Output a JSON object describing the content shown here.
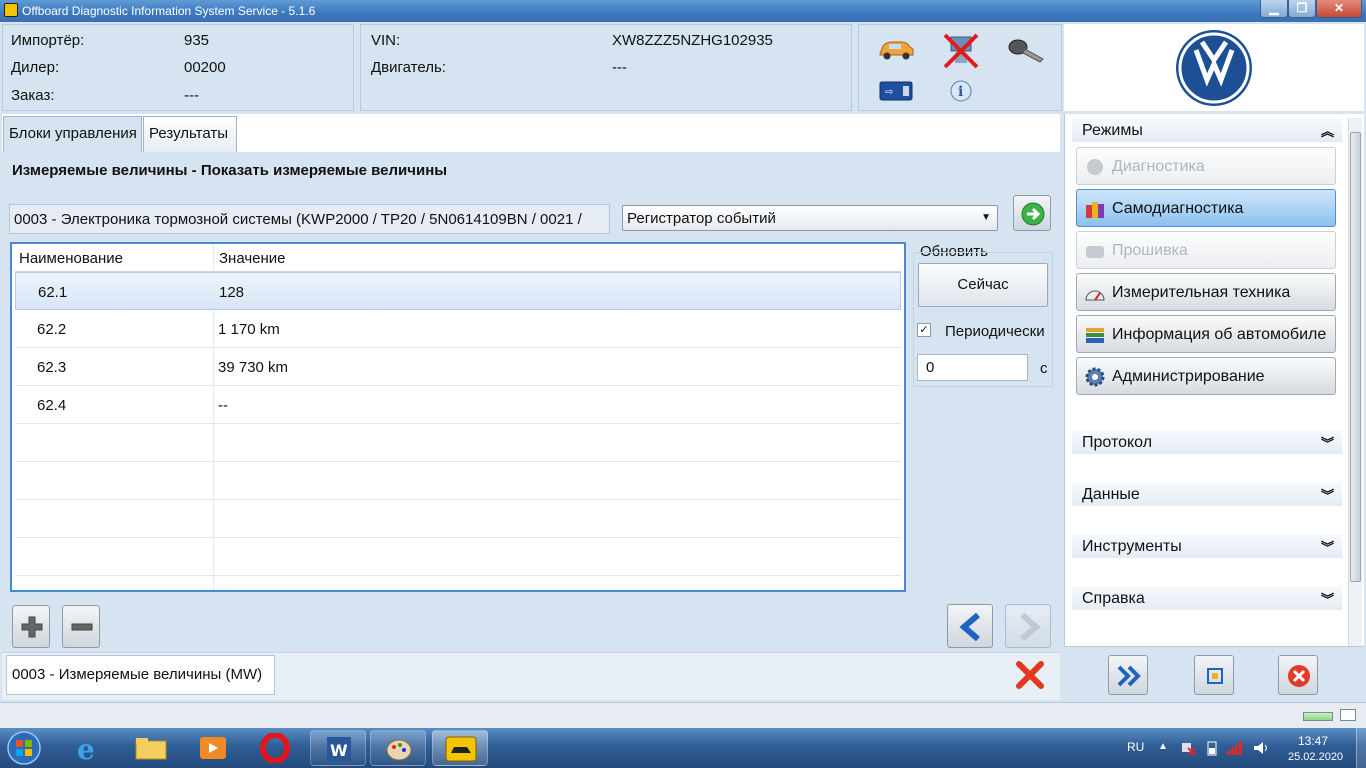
{
  "window": {
    "title": "Offboard Diagnostic Information System Service - 5.1.6"
  },
  "info": {
    "importer_label": "Импортёр:",
    "importer_value": "935",
    "dealer_label": "Дилер:",
    "dealer_value": "00200",
    "order_label": "Заказ:",
    "order_value": "---",
    "vin_label": "VIN:",
    "vin_value": "XW8ZZZ5NZHG102935",
    "engine_label": "Двигатель:",
    "engine_value": "---"
  },
  "tabs": [
    {
      "label": "Блоки управления"
    },
    {
      "label": "Результаты"
    }
  ],
  "main": {
    "heading": "Измеряемые величины - Показать измеряемые величины",
    "ecu_field": "0003 - Электроника тормозной системы  (KWP2000 / TP20 / 5N0614109BN / 0021 /",
    "dropdown_value": "Регистратор событий",
    "table": {
      "columns": [
        "Наименование",
        "Значение"
      ],
      "rows": [
        {
          "name": "62.1",
          "value": "128"
        },
        {
          "name": "62.2",
          "value": "1 170 km"
        },
        {
          "name": "62.3",
          "value": "39 730 km"
        },
        {
          "name": "62.4",
          "value": "--"
        },
        {
          "name": "",
          "value": ""
        },
        {
          "name": "",
          "value": ""
        },
        {
          "name": "",
          "value": ""
        },
        {
          "name": "",
          "value": ""
        }
      ]
    },
    "refresh": {
      "group_label": "Обновить",
      "now_button": "Сейчас",
      "periodic_label": "Периодически",
      "periodic_checked": true,
      "interval_value": "0",
      "interval_unit": "с"
    },
    "footer_tab": "0003 - Измеряемые величины (MW)"
  },
  "sidebar": {
    "modes_header": "Режимы",
    "modes": [
      {
        "label": "Диагностика",
        "state": "disabled",
        "icon": "stethoscope-icon"
      },
      {
        "label": "Самодиагностика",
        "state": "active",
        "icon": "books-icon"
      },
      {
        "label": "Прошивка",
        "state": "disabled",
        "icon": "flash-icon"
      },
      {
        "label": "Измерительная техника",
        "state": "normal",
        "icon": "gauge-icon"
      },
      {
        "label": "Информация об автомобиле",
        "state": "normal",
        "icon": "info-books-icon"
      },
      {
        "label": "Администрирование",
        "state": "normal",
        "icon": "gear-icon"
      }
    ],
    "sections": [
      {
        "label": "Протокол"
      },
      {
        "label": "Данные"
      },
      {
        "label": "Инструменты"
      },
      {
        "label": "Справка"
      }
    ]
  },
  "taskbar": {
    "lang": "RU",
    "time": "13:47",
    "date": "25.02.2020"
  },
  "colors": {
    "accent": "#4a88d0",
    "title_bar": "#3c78bd",
    "active_mode": "#8cc0ef"
  }
}
